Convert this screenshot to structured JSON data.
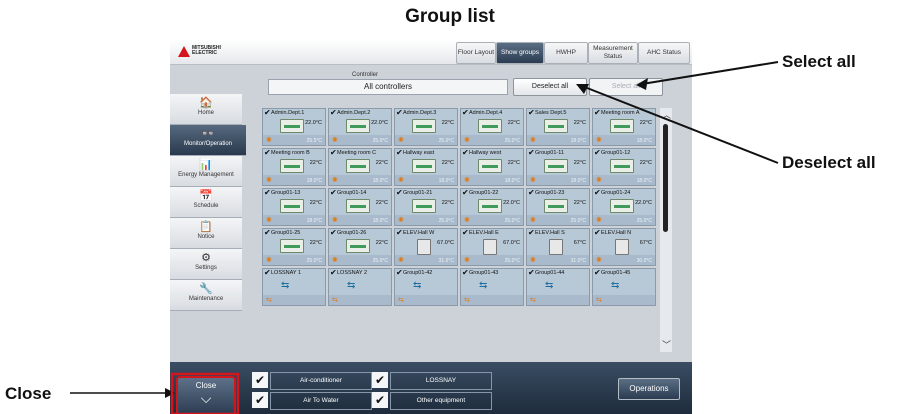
{
  "doc_title": "Group list",
  "callouts": {
    "select_all": "Select all",
    "deselect_all": "Deselect all",
    "close": "Close"
  },
  "top_tabs": [
    {
      "label": "Floor Layout",
      "active": false
    },
    {
      "label": "Show groups",
      "active": true
    },
    {
      "label": "HWHP",
      "active": false
    },
    {
      "label": "Measurement Status",
      "active": false
    },
    {
      "label": "AHC Status",
      "active": false
    }
  ],
  "logo": {
    "line1": "MITSUBISHI",
    "line2": "ELECTRIC"
  },
  "controller": {
    "label": "Controller",
    "value": "All controllers"
  },
  "buttons": {
    "deselect_all": "Deselect all",
    "select_all": "Select all"
  },
  "sidenav": [
    {
      "label": "Home",
      "icon": "house-icon",
      "glyph": "🏠",
      "active": false
    },
    {
      "label": "Monitor/Operation",
      "icon": "glasses-icon",
      "glyph": "👓",
      "active": true
    },
    {
      "label": "Energy Management",
      "icon": "bar-chart-icon",
      "glyph": "📊",
      "active": false
    },
    {
      "label": "Schedule",
      "icon": "calendar-icon",
      "glyph": "📅",
      "active": false
    },
    {
      "label": "Notice",
      "icon": "notice-icon",
      "glyph": "📋",
      "active": false
    },
    {
      "label": "Settings",
      "icon": "gear-icon",
      "glyph": "⚙",
      "active": false
    },
    {
      "label": "Maintenance",
      "icon": "tools-icon",
      "glyph": "🔧",
      "active": false
    }
  ],
  "groups": [
    {
      "name": "Admin.Dept.1",
      "temp": "22.0°C",
      "room": "25.5°C",
      "type": "ac"
    },
    {
      "name": "Admin.Dept.2",
      "temp": "22.0°C",
      "room": "25.0°C",
      "type": "ac"
    },
    {
      "name": "Admin.Dept.3",
      "temp": "22°C",
      "room": "25.0°C",
      "type": "ac"
    },
    {
      "name": "Admin.Dept.4",
      "temp": "22°C",
      "room": "25.0°C",
      "type": "ac"
    },
    {
      "name": "Sales Dept.5",
      "temp": "22°C",
      "room": "18.0°C",
      "type": "ac"
    },
    {
      "name": "Meeting room A",
      "temp": "22°C",
      "room": "18.0°C",
      "type": "ac"
    },
    {
      "name": "Meeting room B",
      "temp": "22°C",
      "room": "18.0°C",
      "type": "ac"
    },
    {
      "name": "Meeting room C",
      "temp": "22°C",
      "room": "18.0°C",
      "type": "ac"
    },
    {
      "name": "Hallway east",
      "temp": "22°C",
      "room": "18.0°C",
      "type": "ac"
    },
    {
      "name": "Hallway west",
      "temp": "22°C",
      "room": "18.0°C",
      "type": "ac"
    },
    {
      "name": "Group01-11",
      "temp": "22°C",
      "room": "18.0°C",
      "type": "ac"
    },
    {
      "name": "Group01-12",
      "temp": "22°C",
      "room": "18.0°C",
      "type": "ac"
    },
    {
      "name": "Group01-13",
      "temp": "22°C",
      "room": "18.0°C",
      "type": "ac"
    },
    {
      "name": "Group01-14",
      "temp": "22°C",
      "room": "18.0°C",
      "type": "ac"
    },
    {
      "name": "Group01-21",
      "temp": "22°C",
      "room": "25.0°C",
      "type": "ac"
    },
    {
      "name": "Group01-22",
      "temp": "22.0°C",
      "room": "25.0°C",
      "type": "ac"
    },
    {
      "name": "Group01-23",
      "temp": "22°C",
      "room": "25.0°C",
      "type": "ac"
    },
    {
      "name": "Group01-24",
      "temp": "22.0°C",
      "room": "25.0°C",
      "type": "ac"
    },
    {
      "name": "Group01-25",
      "temp": "22°C",
      "room": "25.0°C",
      "type": "ac"
    },
    {
      "name": "Group01-26",
      "temp": "22°C",
      "room": "25.0°C",
      "type": "ac"
    },
    {
      "name": "ELEV.Hall W",
      "temp": "67.0°C",
      "room": "31.5°C",
      "type": "water"
    },
    {
      "name": "ELEV.Hall E",
      "temp": "67.0°C",
      "room": "25.0°C",
      "type": "water"
    },
    {
      "name": "ELEV.Hall S",
      "temp": "67°C",
      "room": "31.0°C",
      "type": "water"
    },
    {
      "name": "ELEV.Hall N",
      "temp": "67°C",
      "room": "30.0°C",
      "type": "water"
    },
    {
      "name": "LOSSNAY 1",
      "temp": "",
      "room": "",
      "type": "lossnay"
    },
    {
      "name": "LOSSNAY 2",
      "temp": "",
      "room": "",
      "type": "lossnay"
    },
    {
      "name": "Group01-42",
      "temp": "",
      "room": "",
      "type": "lossnay"
    },
    {
      "name": "Group01-43",
      "temp": "",
      "room": "",
      "type": "lossnay"
    },
    {
      "name": "Group01-44",
      "temp": "",
      "room": "",
      "type": "lossnay"
    },
    {
      "name": "Group01-45",
      "temp": "",
      "room": "",
      "type": "lossnay"
    }
  ],
  "filters": [
    {
      "label": "Air-conditioner",
      "checked": "✔"
    },
    {
      "label": "LOSSNAY",
      "checked": "✔"
    },
    {
      "label": "Air To Water",
      "checked": "✔"
    },
    {
      "label": "Other equipment",
      "checked": "✔"
    }
  ],
  "close_button": {
    "label": "Close",
    "glyph": "⌵"
  },
  "operations_button": {
    "label": "Operations"
  },
  "colors": {
    "brand_red": "#d4151b",
    "nav_dark": "#2a3a4e",
    "tile_bg": "#b7c8d6",
    "highlight_red": "#d4151b"
  }
}
